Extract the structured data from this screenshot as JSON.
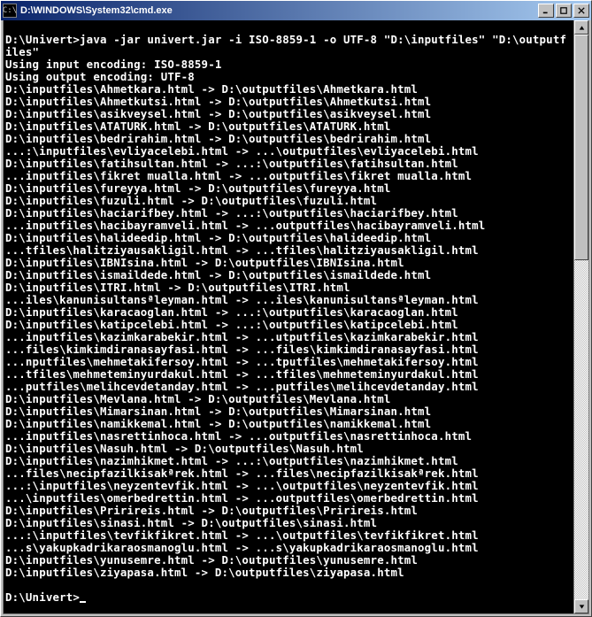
{
  "window": {
    "title": "D:\\WINDOWS\\System32\\cmd.exe",
    "icon_text": "C:\\"
  },
  "colors": {
    "title_gradient_start": "#0a246a",
    "title_gradient_end": "#a6caf0",
    "console_bg": "#000000",
    "console_fg": "#ffffff"
  },
  "console": {
    "prompt": "D:\\Univert>",
    "encoding_in_line": "Using input encoding: ISO-8859-1",
    "encoding_out_line": "Using output encoding: UTF-8",
    "command": "java -jar univert.jar -i ISO-8859-1 -o UTF-8 \"D:\\inputfiles\" \"D:\\outputfiles\"",
    "lines": [
      "D:\\inputfiles\\Ahmetkara.html -> D:\\outputfiles\\Ahmetkara.html",
      "D:\\inputfiles\\Ahmetkutsi.html -> D:\\outputfiles\\Ahmetkutsi.html",
      "D:\\inputfiles\\asikveysel.html -> D:\\outputfiles\\asikveysel.html",
      "D:\\inputfiles\\ATATURK.html -> D:\\outputfiles\\ATATURK.html",
      "D:\\inputfiles\\bedrirahim.html -> D:\\outputfiles\\bedrirahim.html",
      "...:\\inputfiles\\evliyacelebi.html -> ...\\outputfiles\\evliyacelebi.html",
      "D:\\inputfiles\\fatihsultan.html -> ...:\\outputfiles\\fatihsultan.html",
      "...inputfiles\\fikret mualla.html -> ...outputfiles\\fikret mualla.html",
      "D:\\inputfiles\\fureyya.html -> D:\\outputfiles\\fureyya.html",
      "D:\\inputfiles\\fuzuli.html -> D:\\outputfiles\\fuzuli.html",
      "D:\\inputfiles\\haciarifbey.html -> ...:\\outputfiles\\haciarifbey.html",
      "...inputfiles\\hacibayramveli.html -> ...outputfiles\\hacibayramveli.html",
      "D:\\inputfiles\\halideedip.html -> D:\\outputfiles\\halideedip.html",
      "...tfiles\\halitziyausakligil.html -> ...tfiles\\halitziyausakligil.html",
      "D:\\inputfiles\\IBNIsina.html -> D:\\outputfiles\\IBNIsina.html",
      "D:\\inputfiles\\ismaildede.html -> D:\\outputfiles\\ismaildede.html",
      "D:\\inputfiles\\ITRI.html -> D:\\outputfiles\\ITRI.html",
      "...iles\\kanunisultansªleyman.html -> ...iles\\kanunisultansªleyman.html",
      "D:\\inputfiles\\karacaoglan.html -> ...:\\outputfiles\\karacaoglan.html",
      "D:\\inputfiles\\katipcelebi.html -> ...:\\outputfiles\\katipcelebi.html",
      "...inputfiles\\kazimkarabekir.html -> ...utputfiles\\kazimkarabekir.html",
      "...files\\kimkimdiranasayfasi.html -> ...files\\kimkimdiranasayfasi.html",
      "...nputfiles\\mehmetakifersoy.html -> ...tputfiles\\mehmetakifersoy.html",
      "...tfiles\\mehmeteminyurdakul.html -> ...tfiles\\mehmeteminyurdakul.html",
      "...putfiles\\melihcevdetanday.html -> ...putfiles\\melihcevdetanday.html",
      "D:\\inputfiles\\Mevlana.html -> D:\\outputfiles\\Mevlana.html",
      "D:\\inputfiles\\Mimarsinan.html -> D:\\outputfiles\\Mimarsinan.html",
      "D:\\inputfiles\\namikkemal.html -> D:\\outputfiles\\namikkemal.html",
      "...inputfiles\\nasrettinhoca.html -> ...outputfiles\\nasrettinhoca.html",
      "D:\\inputfiles\\Nasuh.html -> D:\\outputfiles\\Nasuh.html",
      "D:\\inputfiles\\nazimhikmet.html -> ...:\\outputfiles\\nazimhikmet.html",
      "...files\\necipfazilkisakªrek.html -> ...files\\necipfazilkisakªrek.html",
      "...:\\inputfiles\\neyzentevfik.html -> ...\\outputfiles\\neyzentevfik.html",
      "...\\inputfiles\\omerbedrettin.html -> ...outputfiles\\omerbedrettin.html",
      "D:\\inputfiles\\Pririreis.html -> D:\\outputfiles\\Pririreis.html",
      "D:\\inputfiles\\sinasi.html -> D:\\outputfiles\\sinasi.html",
      "...:\\inputfiles\\tevfikfikret.html -> ...\\outputfiles\\tevfikfikret.html",
      "...s\\yakupkadrikaraosmanoglu.html -> ...s\\yakupkadrikaraosmanoglu.html",
      "D:\\inputfiles\\yunusemre.html -> D:\\outputfiles\\yunusemre.html",
      "D:\\inputfiles\\ziyapasa.html -> D:\\outputfiles\\ziyapasa.html"
    ]
  }
}
